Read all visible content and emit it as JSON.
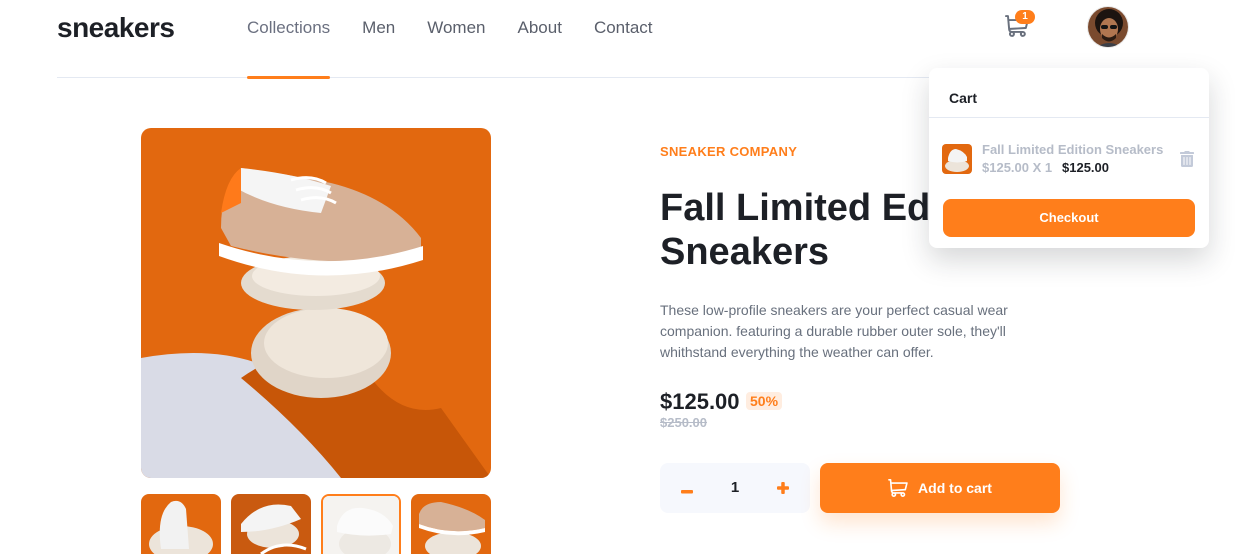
{
  "brand": {
    "logo": "sneakers"
  },
  "nav": {
    "items": [
      {
        "label": "Collections",
        "active": true
      },
      {
        "label": "Men"
      },
      {
        "label": "Women"
      },
      {
        "label": "About"
      },
      {
        "label": "Contact"
      }
    ]
  },
  "header": {
    "cart_icon": "cart-icon",
    "cart_count": "1",
    "avatar": "user-avatar"
  },
  "product": {
    "company": "SNEAKER COMPANY",
    "title": "Fall Limited Edition Sneakers",
    "description": "These low-profile sneakers are your perfect casual wear companion. featuring a durable rubber outer sole, they'll whithstand everything the weather can offer.",
    "price": "$125.00",
    "discount": "50%",
    "old_price": "$250.00",
    "quantity": "1",
    "add_to_cart_label": "Add to cart",
    "selected_thumbnail": 3
  },
  "cart": {
    "title": "Cart",
    "items": [
      {
        "name": "Fall Limited Edition Sneakers",
        "calc": "$125.00 X 1",
        "total": "$125.00"
      }
    ],
    "checkout_label": "Checkout"
  },
  "colors": {
    "accent": "#ff7e1b",
    "accent_light": "#ffede0",
    "dark": "#1d2026",
    "muted": "#68707d",
    "faint": "#b6bcc8"
  }
}
